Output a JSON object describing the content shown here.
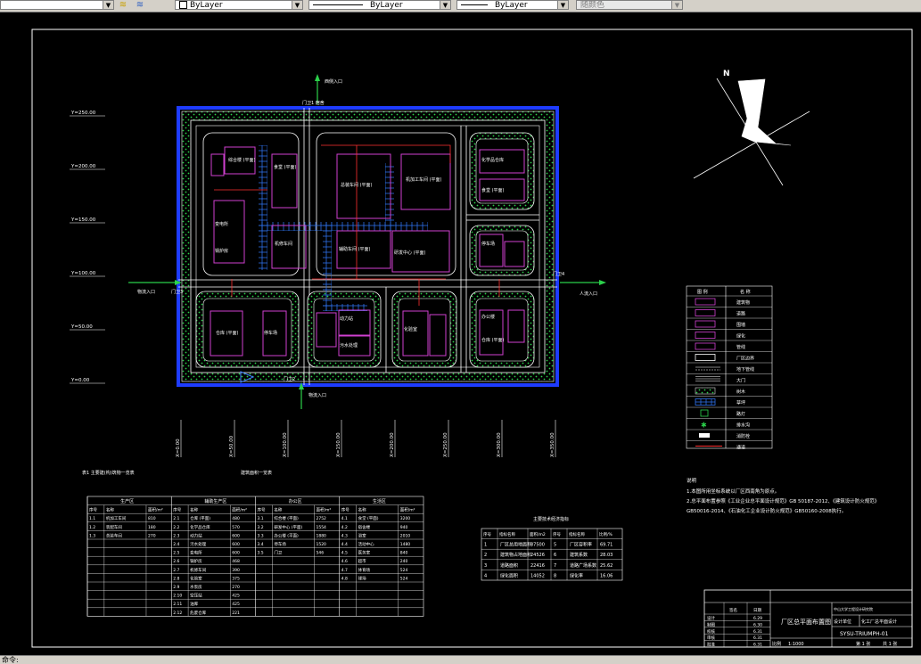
{
  "toolbar": {
    "color_control": "ByLayer",
    "linetype_control": "ByLayer",
    "lineweight_control": "ByLayer",
    "plotstyle_control": "随颜色"
  },
  "statusbar": {
    "prompt": "命令:"
  },
  "drawing": {
    "north_label": "N",
    "gates": {
      "north": "门卫1 宿舍",
      "north_entry": "西侧入口",
      "west": "门卫3",
      "west_entry": "物流入口",
      "east": "门卫4",
      "east_entry": "人流入口",
      "south": "门卫2",
      "south_entry": "物流入口"
    },
    "y_axis": [
      "Y=250.00",
      "Y=200.00",
      "Y=150.00",
      "Y=100.00",
      "Y=50.00",
      "Y=0.00"
    ],
    "x_axis": [
      "X=0.00",
      "X=50.00",
      "X=100.00",
      "X=150.00",
      "X=200.00",
      "X=250.00",
      "X=300.00",
      "X=350.00"
    ],
    "buildings": {
      "b1": "综合楼 (平面)",
      "b2": "食堂 (平面)",
      "b3": "总装车间 (平面)",
      "b4": "机加工车间 (平面)",
      "b5": "仓库 (平面)",
      "b6": "化学品仓库",
      "b7": "动力站",
      "b8": "污水处理",
      "b9": "变电所",
      "b10": "锅炉房",
      "b11": "研发中心 (平面)",
      "b12": "停车场",
      "b13": "仓库 (平面)",
      "b14": "辅助车间 (平面)",
      "b15": "机修车间",
      "b16": "化验室",
      "b17": "办公楼"
    },
    "legend": {
      "header_symbol": "图 例",
      "header_name": "名 称",
      "rows": [
        "建筑物",
        "道路",
        "围墙",
        "绿化",
        "管线",
        "厂区边界",
        "地下管线",
        "大门",
        "树木",
        "草坪",
        "路灯",
        "排水沟",
        "消防栓",
        "通道"
      ]
    },
    "notes": {
      "title": "说明",
      "lines": [
        "1.本图所用坐标系统以厂区西南角为原点。",
        "2.总平面布置参照《工业企业总平面设计规范》GB 50187-2012、《建筑设计防火规范》",
        "GB50016-2014、《石油化工企业设计防火规范》GB50160-2008执行。"
      ]
    },
    "table1": {
      "title": "表1 主要建(构)筑物一览表",
      "subtitle": "建筑面积一览表",
      "groups": [
        "生产区",
        "辅助生产区",
        "办公区",
        "生活区"
      ],
      "cols": [
        "序号",
        "名称",
        "面积/m²"
      ],
      "rows": [
        [
          "1.1",
          "机加工车间",
          "810",
          "2.1",
          "仓库 (平面)",
          "480",
          "3.1",
          "综合楼 (平面)",
          "2752",
          "4.1",
          "食堂 (平面)",
          "3200"
        ],
        [
          "1.2",
          "装配车间",
          "180",
          "2.2",
          "化学品仓库",
          "570",
          "3.2",
          "研发中心 (平面)",
          "1554",
          "4.2",
          "宿舍楼",
          "940"
        ],
        [
          "1.3",
          "总装车间",
          "270",
          "2.3",
          "动力站",
          "600",
          "3.3",
          "办公楼 (平面)",
          "1880",
          "4.3",
          "浴室",
          "2010"
        ],
        [
          "",
          "",
          "",
          "2.4",
          "污水处理",
          "600",
          "3.4",
          "停车场",
          "1520",
          "4.4",
          "活动中心",
          "1480"
        ],
        [
          "",
          "",
          "",
          "2.5",
          "变电所",
          "600",
          "3.5",
          "门卫",
          "546",
          "4.5",
          "医务室",
          "840"
        ],
        [
          "",
          "",
          "",
          "2.6",
          "锅炉房",
          "468",
          "",
          "",
          "",
          "4.6",
          "超市",
          "240"
        ],
        [
          "",
          "",
          "",
          "2.7",
          "机修车间",
          "390",
          "",
          "",
          "",
          "4.7",
          "体育场",
          "524"
        ],
        [
          "",
          "",
          "",
          "2.8",
          "化验室",
          "375",
          "",
          "",
          "",
          "4.8",
          "球场",
          "524"
        ],
        [
          "",
          "",
          "",
          "2.9",
          "水泵房",
          "270",
          "",
          "",
          "",
          "",
          "",
          ""
        ],
        [
          "",
          "",
          "",
          "2.10",
          "空压站",
          "425",
          "",
          "",
          "",
          "",
          "",
          ""
        ],
        [
          "",
          "",
          "",
          "2.11",
          "油库",
          "425",
          "",
          "",
          "",
          "",
          "",
          ""
        ],
        [
          "",
          "",
          "",
          "2.12",
          "危废仓库",
          "221",
          "",
          "",
          "",
          "",
          "",
          ""
        ]
      ]
    },
    "table2": {
      "title": "主要技术经济指标",
      "cols": [
        "序号",
        "指标名称",
        "面积/m2",
        "序号",
        "指标名称",
        "比例/%"
      ],
      "rows": [
        [
          "1",
          "厂区总用地面积",
          "87500",
          "5",
          "厂区容积率",
          "69.71"
        ],
        [
          "2",
          "建筑物占地面积",
          "24526",
          "6",
          "建筑系数",
          "28.03"
        ],
        [
          "3",
          "道路面积",
          "22416",
          "7",
          "道路广场系数",
          "25.62"
        ],
        [
          "4",
          "绿化面积",
          "14052",
          "8",
          "绿化率",
          "16.06"
        ]
      ]
    },
    "title_block": {
      "drawing_name": "厂区总平面布置图",
      "drawing_no": "SYSU-TRIUMPH-01",
      "scale_label": "比例",
      "scale": "1:1000",
      "sheet": "第 1 张",
      "total": "共 1 张",
      "company": "中山大学工程设计研究院",
      "project": "化工厂总平面设计",
      "project_label": "设计项目",
      "dept_label": "设计单位",
      "sign_cols": [
        "签名",
        "日期"
      ],
      "sign_rows": [
        [
          "设计",
          "6.29"
        ],
        [
          "制图",
          "6.30"
        ],
        [
          "校核",
          "6.31"
        ],
        [
          "审核",
          "6.31"
        ],
        [
          "批准",
          "6.31"
        ]
      ]
    }
  }
}
